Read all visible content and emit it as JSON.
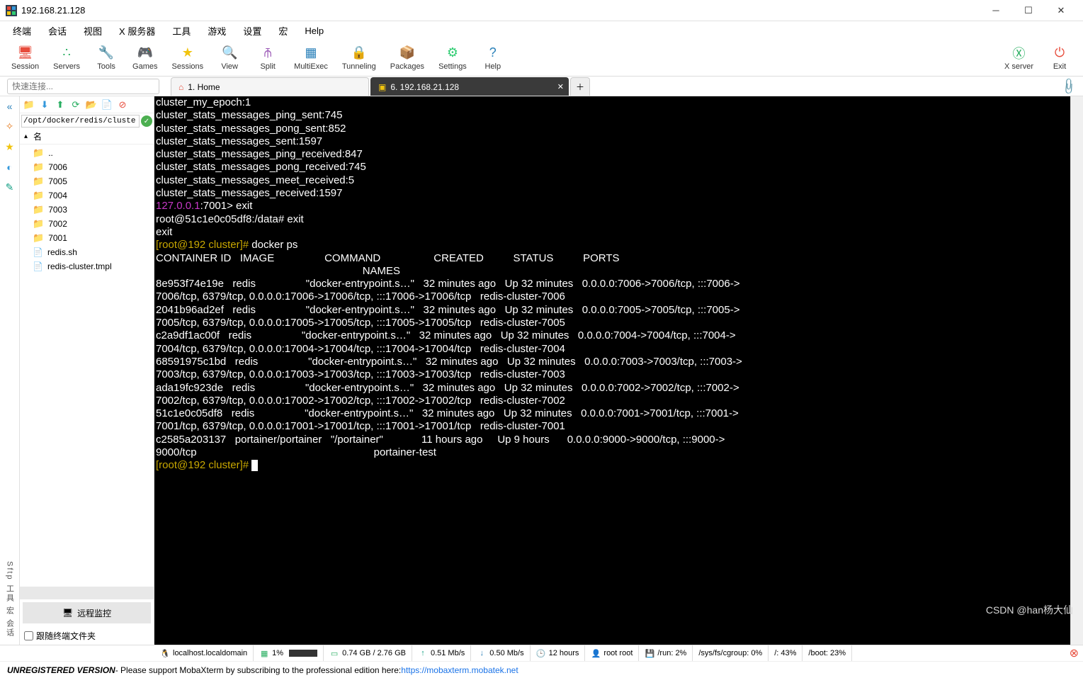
{
  "window": {
    "title": "192.168.21.128"
  },
  "menus": [
    "终端",
    "会话",
    "视图",
    "X 服务器",
    "工具",
    "游戏",
    "设置",
    "宏",
    "Help"
  ],
  "toolbar": [
    {
      "label": "Session",
      "color": "#e74c3c"
    },
    {
      "label": "Servers",
      "color": "#27ae60"
    },
    {
      "label": "Tools",
      "color": "#e67e22"
    },
    {
      "label": "Games",
      "color": "#8e44ad"
    },
    {
      "label": "Sessions",
      "color": "#f1c40f"
    },
    {
      "label": "View",
      "color": "#3498db"
    },
    {
      "label": "Split",
      "color": "#9b59b6"
    },
    {
      "label": "MultiExec",
      "color": "#2980b9"
    },
    {
      "label": "Tunneling",
      "color": "#16a085"
    },
    {
      "label": "Packages",
      "color": "#d35400"
    },
    {
      "label": "Settings",
      "color": "#2ecc71"
    },
    {
      "label": "Help",
      "color": "#2980b9"
    }
  ],
  "toolbar_right": [
    {
      "label": "X server",
      "color": "#27ae60"
    },
    {
      "label": "Exit",
      "color": "#e74c3c"
    }
  ],
  "quick_connect_placeholder": "快速连接...",
  "tabs": {
    "home": "1. Home",
    "active": "6. 192.168.21.128",
    "add": "+"
  },
  "sidebar": {
    "path": "/opt/docker/redis/cluste",
    "header": "名",
    "items": [
      {
        "type": "up",
        "name": ".."
      },
      {
        "type": "folder",
        "name": "7006"
      },
      {
        "type": "folder",
        "name": "7005"
      },
      {
        "type": "folder",
        "name": "7004"
      },
      {
        "type": "folder",
        "name": "7003"
      },
      {
        "type": "folder",
        "name": "7002"
      },
      {
        "type": "folder",
        "name": "7001"
      },
      {
        "type": "file",
        "name": "redis.sh"
      },
      {
        "type": "file",
        "name": "redis-cluster.tmpl"
      }
    ],
    "monitor": "远程监控",
    "follow": "跟随终端文件夹"
  },
  "leftstrip_label": "Sftp  工具  宏  会话",
  "terminal_lines": [
    {
      "t": "cluster_my_epoch:1"
    },
    {
      "t": "cluster_stats_messages_ping_sent:745"
    },
    {
      "t": "cluster_stats_messages_pong_sent:852"
    },
    {
      "t": "cluster_stats_messages_sent:1597"
    },
    {
      "t": "cluster_stats_messages_ping_received:847"
    },
    {
      "t": "cluster_stats_messages_pong_received:745"
    },
    {
      "t": "cluster_stats_messages_meet_received:5"
    },
    {
      "t": "cluster_stats_messages_received:1597"
    },
    {
      "pre": "127.0.0.1",
      "precls": "mag",
      "t": ":7001> exit"
    },
    {
      "t": "root@51c1e0c05df8:/data# exit"
    },
    {
      "t": "exit"
    },
    {
      "pre": "[root@192 cluster]# ",
      "precls": "yel",
      "t": "docker ps"
    },
    {
      "t": "CONTAINER ID   IMAGE                 COMMAND                  CREATED          STATUS          PORTS                                                                                                  NAMES"
    },
    {
      "t": "8e953f74e19e   redis                 \"docker-entrypoint.s…\"   32 minutes ago   Up 32 minutes   0.0.0.0:7006->7006/tcp, :::7006->7006/tcp, 6379/tcp, 0.0.0.0:17006->17006/tcp, :::17006->17006/tcp   redis-cluster-7006"
    },
    {
      "t": "2041b96ad2ef   redis                 \"docker-entrypoint.s…\"   32 minutes ago   Up 32 minutes   0.0.0.0:7005->7005/tcp, :::7005->7005/tcp, 6379/tcp, 0.0.0.0:17005->17005/tcp, :::17005->17005/tcp   redis-cluster-7005"
    },
    {
      "t": "c2a9df1ac00f   redis                 \"docker-entrypoint.s…\"   32 minutes ago   Up 32 minutes   0.0.0.0:7004->7004/tcp, :::7004->7004/tcp, 6379/tcp, 0.0.0.0:17004->17004/tcp, :::17004->17004/tcp   redis-cluster-7004"
    },
    {
      "t": "68591975c1bd   redis                 \"docker-entrypoint.s…\"   32 minutes ago   Up 32 minutes   0.0.0.0:7003->7003/tcp, :::7003->7003/tcp, 6379/tcp, 0.0.0.0:17003->17003/tcp, :::17003->17003/tcp   redis-cluster-7003"
    },
    {
      "t": "ada19fc923de   redis                 \"docker-entrypoint.s…\"   32 minutes ago   Up 32 minutes   0.0.0.0:7002->7002/tcp, :::7002->7002/tcp, 6379/tcp, 0.0.0.0:17002->17002/tcp, :::17002->17002/tcp   redis-cluster-7002"
    },
    {
      "t": "51c1e0c05df8   redis                 \"docker-entrypoint.s…\"   32 minutes ago   Up 32 minutes   0.0.0.0:7001->7001/tcp, :::7001->7001/tcp, 6379/tcp, 0.0.0.0:17001->17001/tcp, :::17001->17001/tcp   redis-cluster-7001"
    },
    {
      "t": "c2585a203137   portainer/portainer   \"/portainer\"             11 hours ago     Up 9 hours      0.0.0.0:9000->9000/tcp, :::9000->9000/tcp                                                            portainer-test"
    },
    {
      "pre": "[root@192 cluster]# ",
      "precls": "yel",
      "t": "",
      "cursor": true
    }
  ],
  "status": {
    "host": "localhost.localdomain",
    "cpu": "1%",
    "mem": "0.74 GB / 2.76 GB",
    "up": "0.51 Mb/s",
    "down": "0.50 Mb/s",
    "uptime": "12 hours",
    "user": "root  root",
    "disks": [
      "/run: 2%",
      "/sys/fs/cgroup: 0%",
      "/: 43%",
      "/boot: 23%"
    ]
  },
  "bottom": {
    "unreg": "UNREGISTERED VERSION",
    "msg": " -  Please support MobaXterm by subscribing to the professional edition here:  ",
    "link": "https://mobaxterm.mobatek.net"
  },
  "watermark": "CSDN @han杨大仙"
}
